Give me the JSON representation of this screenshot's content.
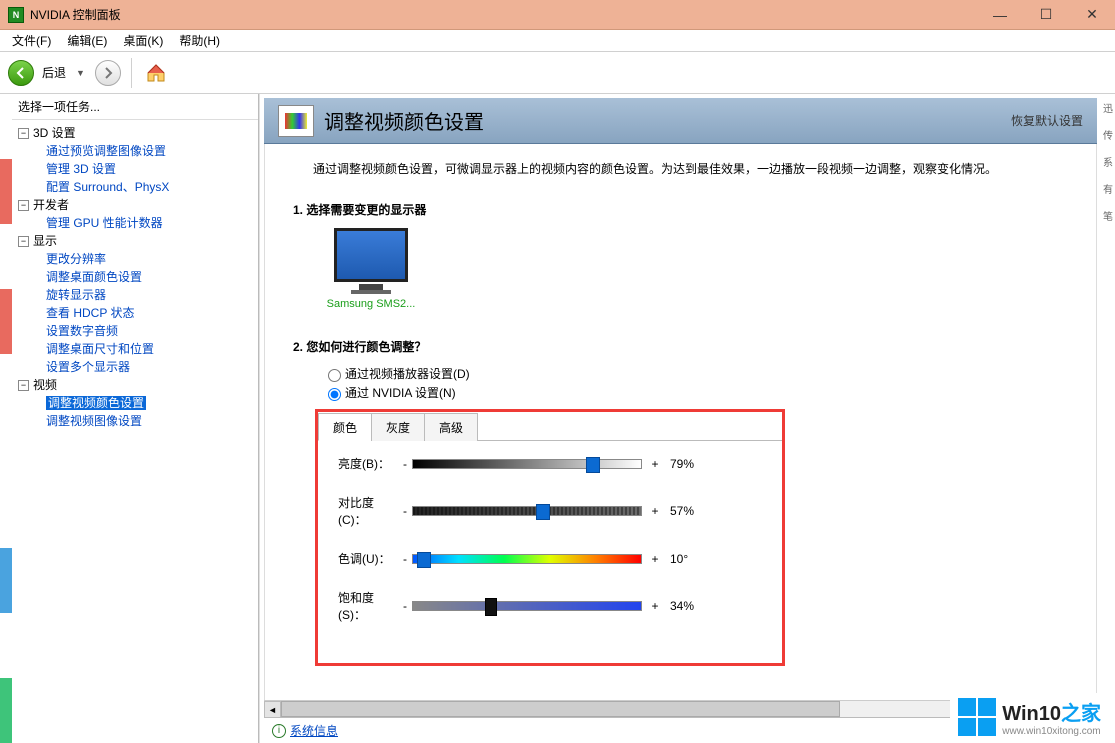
{
  "title": "NVIDIA 控制面板",
  "menubar": [
    "文件(F)",
    "编辑(E)",
    "桌面(K)",
    "帮助(H)"
  ],
  "toolbar": {
    "back_label": "后退"
  },
  "sidebar": {
    "header": "选择一项任务...",
    "groups": [
      {
        "label": "3D 设置",
        "items": [
          "通过预览调整图像设置",
          "管理 3D 设置",
          "配置 Surround、PhysX"
        ]
      },
      {
        "label": "开发者",
        "items": [
          "管理 GPU 性能计数器"
        ]
      },
      {
        "label": "显示",
        "items": [
          "更改分辨率",
          "调整桌面颜色设置",
          "旋转显示器",
          "查看 HDCP 状态",
          "设置数字音频",
          "调整桌面尺寸和位置",
          "设置多个显示器"
        ]
      },
      {
        "label": "视频",
        "items": [
          "调整视频颜色设置",
          "调整视频图像设置"
        ],
        "selected": 0
      }
    ]
  },
  "main": {
    "title": "调整视频颜色设置",
    "restore": "恢复默认设置",
    "desc": "通过调整视频颜色设置，可微调显示器上的视频内容的颜色设置。为达到最佳效果，一边播放一段视频一边调整，观察变化情况。",
    "step1": "1. 选择需要变更的显示器",
    "display_label": "Samsung SMS2...",
    "step2": "2. 您如何进行颜色调整？",
    "radio1": "通过视频播放器设置(D)",
    "radio2": "通过 NVIDIA 设置(N)",
    "tabs": [
      "颜色",
      "灰度",
      "高级"
    ],
    "sliders": [
      {
        "label": "亮度(B)：",
        "value": "79%",
        "pos": 79,
        "track": "brightness",
        "thumb": "blue"
      },
      {
        "label": "对比度(C)：",
        "value": "57%",
        "pos": 57,
        "track": "contrast",
        "thumb": "blue"
      },
      {
        "label": "色调(U)：",
        "value": "10°",
        "pos": 5,
        "track": "hue",
        "thumb": "blue"
      },
      {
        "label": "饱和度(S)：",
        "value": "34%",
        "pos": 34,
        "track": "sat",
        "thumb": "dark"
      }
    ]
  },
  "status": {
    "sysinfo": "系统信息"
  },
  "footer": {
    "brand_en": "Win10",
    "brand_zh": "之家",
    "url": "www.win10xitong.com"
  }
}
